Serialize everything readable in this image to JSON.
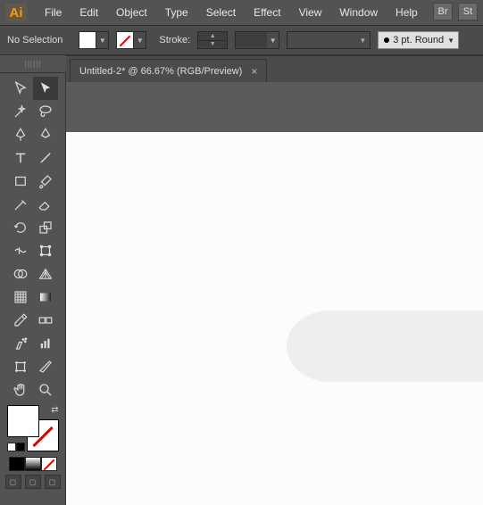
{
  "app": {
    "logo_text": "Ai"
  },
  "menu": [
    "File",
    "Edit",
    "Object",
    "Type",
    "Select",
    "Effect",
    "View",
    "Window",
    "Help"
  ],
  "side_apps": [
    "Br",
    "St"
  ],
  "controlbar": {
    "no_selection": "No Selection",
    "stroke_label": "Stroke:",
    "brush_label": "3 pt. Round"
  },
  "tab": {
    "title": "Untitled-2* @ 66.67% (RGB/Preview)"
  },
  "collapse_glyph": "||||||",
  "tools": {
    "row1": [
      "selection-tool",
      "direct-selection-tool"
    ],
    "row2": [
      "magic-wand-tool",
      "lasso-tool"
    ],
    "row3": [
      "pen-tool",
      "curvature-tool"
    ],
    "row4": [
      "type-tool",
      "line-segment-tool"
    ],
    "row5": [
      "rectangle-tool",
      "paintbrush-tool"
    ],
    "row6": [
      "shaper-tool",
      "eraser-tool"
    ],
    "row7": [
      "rotate-tool",
      "scale-tool"
    ],
    "row8": [
      "width-tool",
      "free-transform-tool"
    ],
    "row9": [
      "shape-builder-tool",
      "perspective-grid-tool"
    ],
    "row10": [
      "mesh-tool",
      "gradient-tool"
    ],
    "row11": [
      "eyedropper-tool",
      "blend-tool"
    ],
    "row12": [
      "symbol-sprayer-tool",
      "column-graph-tool"
    ],
    "row13": [
      "artboard-tool",
      "slice-tool"
    ],
    "row14": [
      "hand-tool",
      "zoom-tool"
    ]
  }
}
